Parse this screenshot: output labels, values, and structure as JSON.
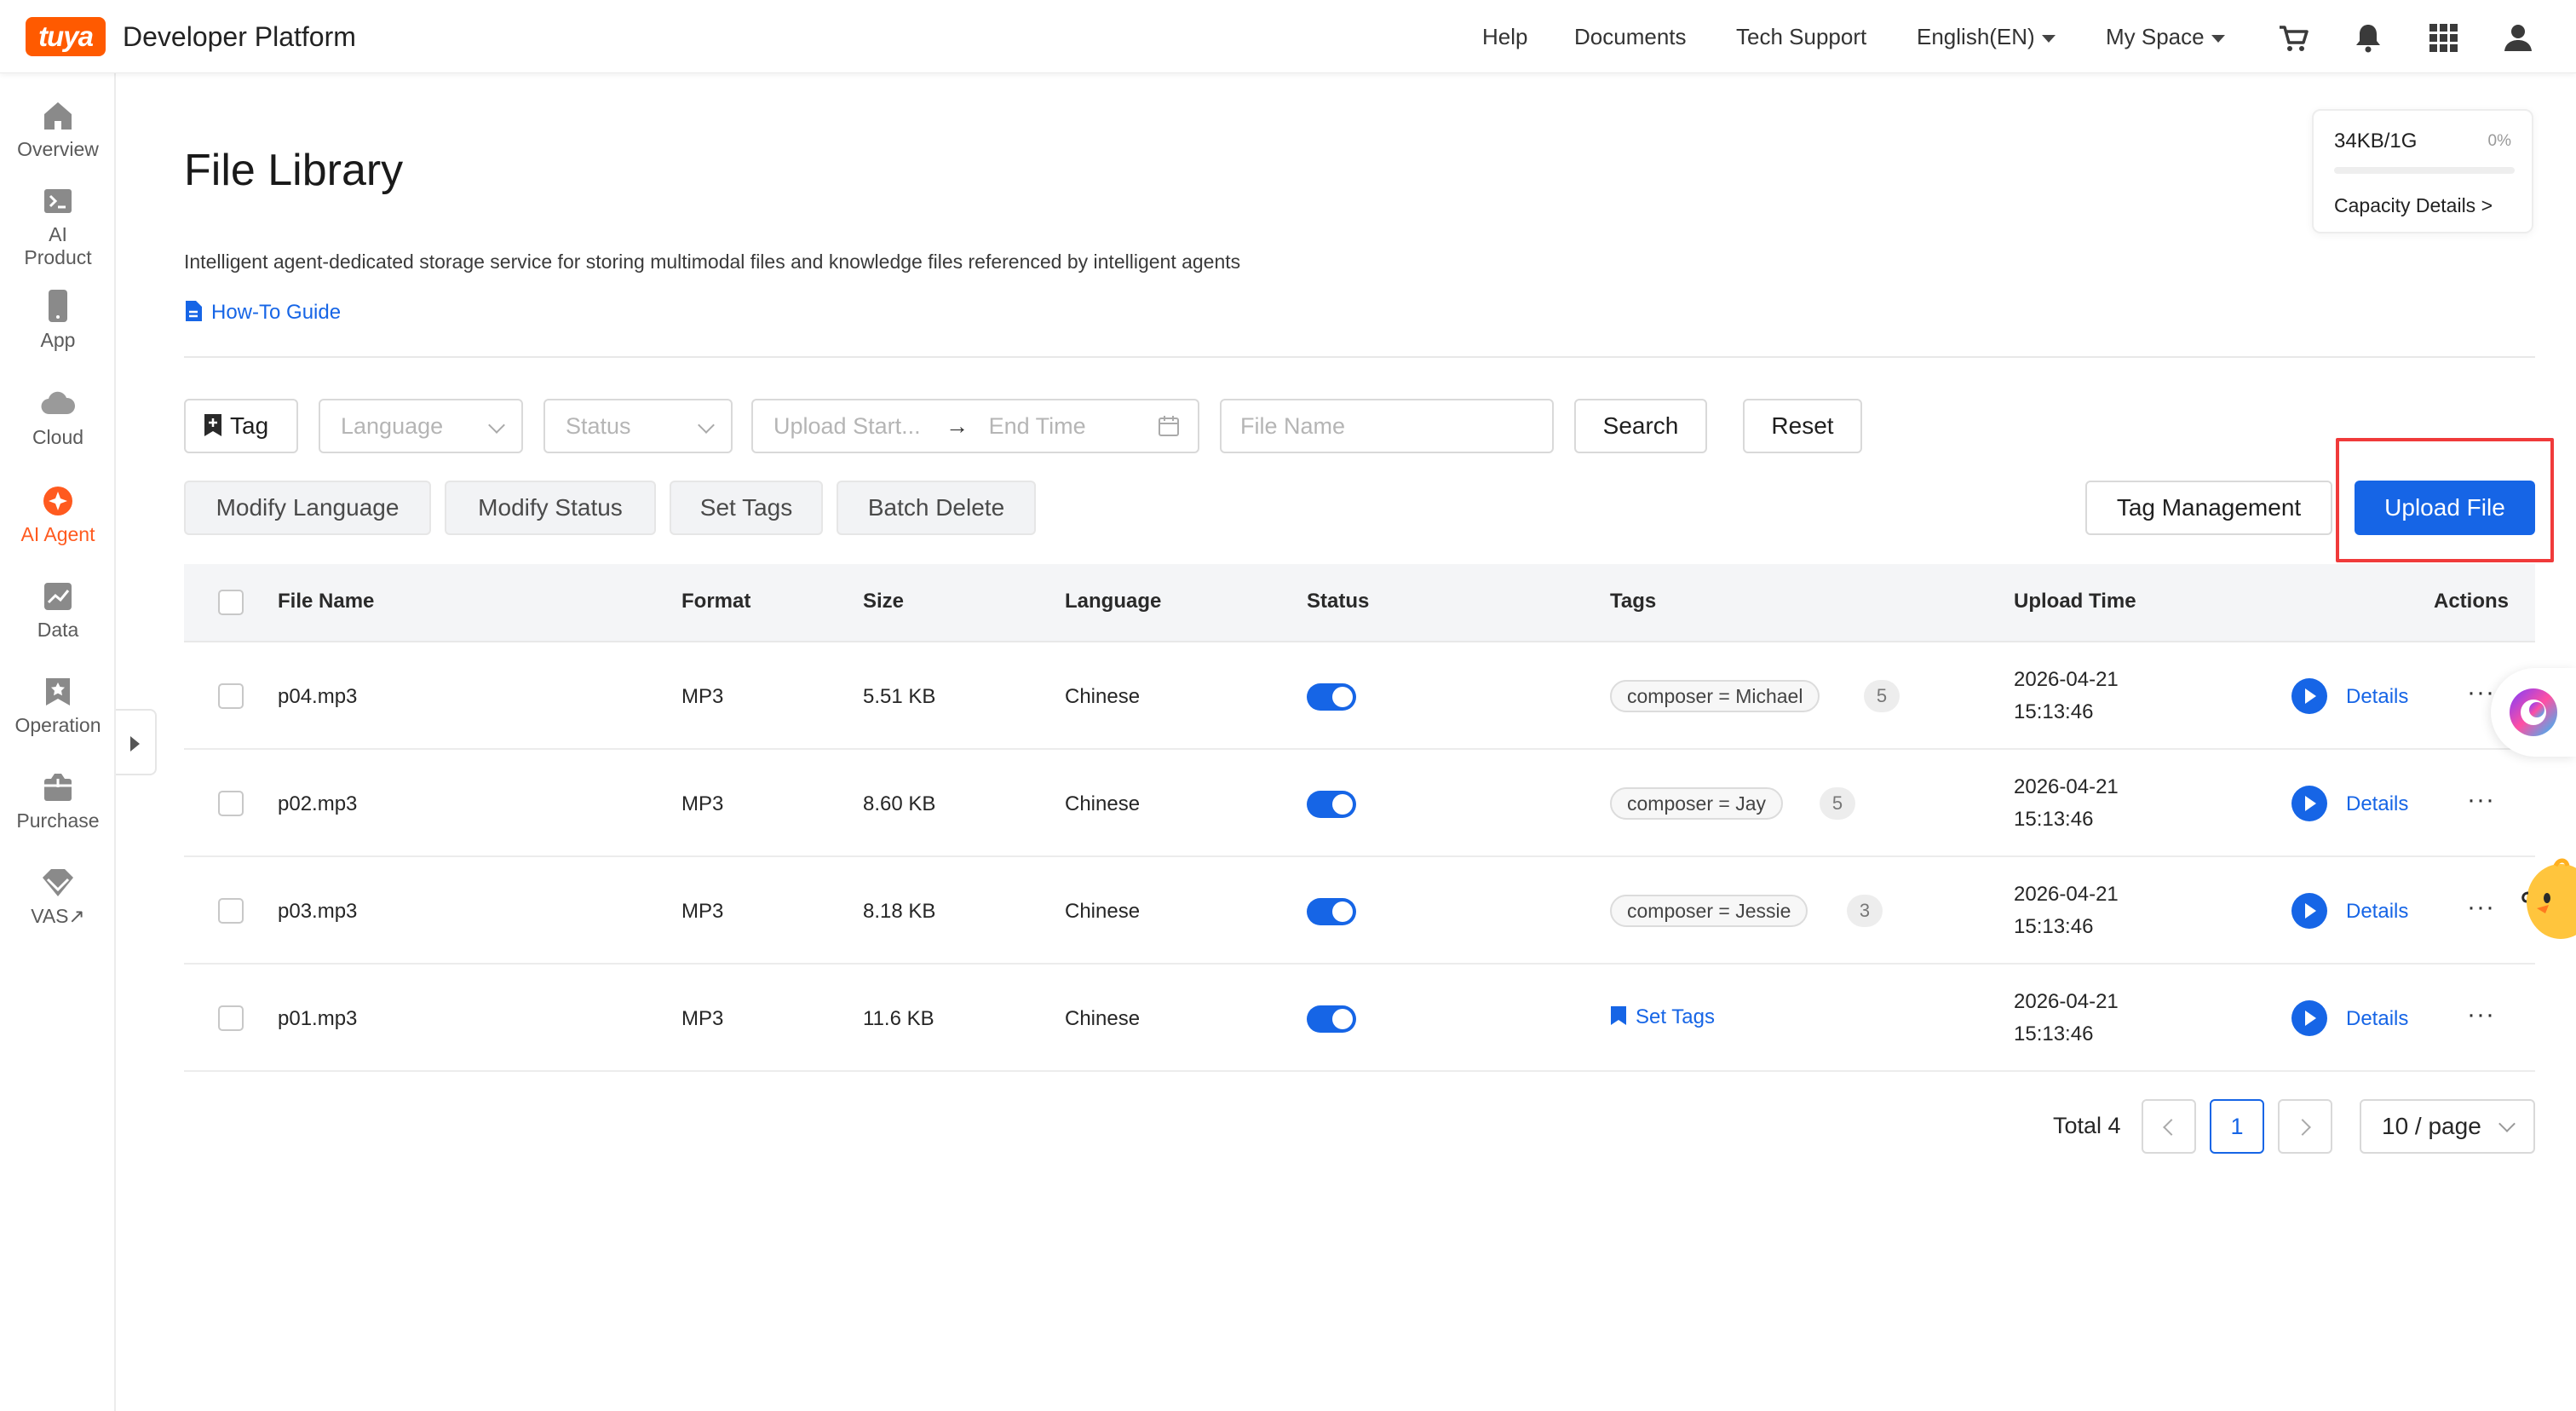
{
  "topbar": {
    "logo_text": "tuya",
    "brand": "Developer Platform",
    "nav": [
      "Help",
      "Documents",
      "Tech Support"
    ],
    "language": "English(EN)",
    "space": "My Space",
    "icons": [
      "cart-icon",
      "bell-icon",
      "apps-grid-icon",
      "user-icon"
    ]
  },
  "sidebar": {
    "items": [
      {
        "label": "Overview",
        "icon": "home-icon"
      },
      {
        "label": "AI Product",
        "icon": "terminal-icon"
      },
      {
        "label": "App",
        "icon": "phone-icon"
      },
      {
        "label": "Cloud",
        "icon": "cloud-icon"
      },
      {
        "label": "AI Agent",
        "icon": "agent-icon",
        "active": true
      },
      {
        "label": "Data",
        "icon": "chart-icon"
      },
      {
        "label": "Operation",
        "icon": "star-badge-icon"
      },
      {
        "label": "Purchase",
        "icon": "package-icon"
      },
      {
        "label": "VAS",
        "icon": "diamond-icon"
      }
    ],
    "ai_line1": "AI",
    "ai_line2": "Product",
    "vas_arrow": "↗"
  },
  "page": {
    "title": "File Library",
    "description": "Intelligent agent-dedicated storage service for storing multimodal files and knowledge files referenced by intelligent agents",
    "guide_link": "How-To Guide"
  },
  "capacity": {
    "used": "34KB/1G",
    "percent_label": "0%",
    "percent": 0,
    "link": "Capacity Details"
  },
  "filters": {
    "tag_label": "Tag",
    "language_placeholder": "Language",
    "status_placeholder": "Status",
    "start_placeholder": "Upload Start...",
    "end_placeholder": "End Time",
    "filename_placeholder": "File Name",
    "search": "Search",
    "reset": "Reset"
  },
  "actions": {
    "modify_language": "Modify Language",
    "modify_status": "Modify Status",
    "set_tags": "Set Tags",
    "batch_delete": "Batch Delete",
    "tag_management": "Tag Management",
    "upload_file": "Upload File"
  },
  "table": {
    "columns": [
      "File Name",
      "Format",
      "Size",
      "Language",
      "Status",
      "Tags",
      "Upload Time",
      "Actions"
    ],
    "rows": [
      {
        "name": "p04.mp3",
        "format": "MP3",
        "size": "5.51 KB",
        "language": "Chinese",
        "enabled": true,
        "tag": "composer = Michael",
        "tag_count": "5",
        "date": "2026-04-21",
        "time": "15:13:46",
        "action": "Details"
      },
      {
        "name": "p02.mp3",
        "format": "MP3",
        "size": "8.60 KB",
        "language": "Chinese",
        "enabled": true,
        "tag": "composer = Jay",
        "tag_count": "5",
        "date": "2026-04-21",
        "time": "15:13:46",
        "action": "Details"
      },
      {
        "name": "p03.mp3",
        "format": "MP3",
        "size": "8.18 KB",
        "language": "Chinese",
        "enabled": true,
        "tag": "composer = Jessie",
        "tag_count": "3",
        "date": "2026-04-21",
        "time": "15:13:46",
        "action": "Details"
      },
      {
        "name": "p01.mp3",
        "format": "MP3",
        "size": "11.6 KB",
        "language": "Chinese",
        "enabled": true,
        "tag": "",
        "set_tags": "Set Tags",
        "date": "2026-04-21",
        "time": "15:13:46",
        "action": "Details"
      }
    ],
    "more": "···"
  },
  "pagination": {
    "total_label": "Total 4",
    "current_page": "1",
    "page_size": "10 / page"
  },
  "colors": {
    "primary": "#1665e6",
    "brand_orange": "#ff5a00",
    "highlight_red": "#f03a3a"
  }
}
